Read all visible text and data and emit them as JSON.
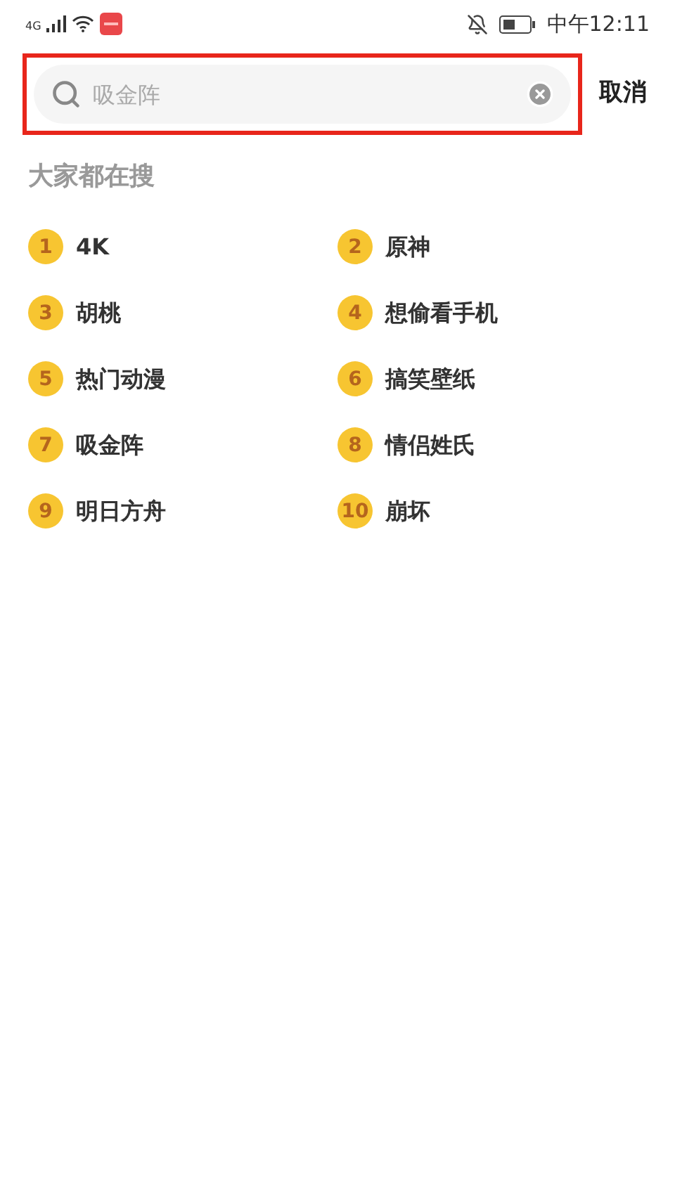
{
  "status_bar": {
    "network": "4G",
    "time": "中午12:11"
  },
  "search": {
    "placeholder": "吸金阵",
    "cancel": "取消"
  },
  "section_title": "大家都在搜",
  "trending": [
    {
      "rank": "1",
      "label": "4K"
    },
    {
      "rank": "2",
      "label": "原神"
    },
    {
      "rank": "3",
      "label": "胡桃"
    },
    {
      "rank": "4",
      "label": "想偷看手机"
    },
    {
      "rank": "5",
      "label": "热门动漫"
    },
    {
      "rank": "6",
      "label": "搞笑壁纸"
    },
    {
      "rank": "7",
      "label": "吸金阵"
    },
    {
      "rank": "8",
      "label": "情侣姓氏"
    },
    {
      "rank": "9",
      "label": "明日方舟"
    },
    {
      "rank": "10",
      "label": "崩坏"
    }
  ]
}
